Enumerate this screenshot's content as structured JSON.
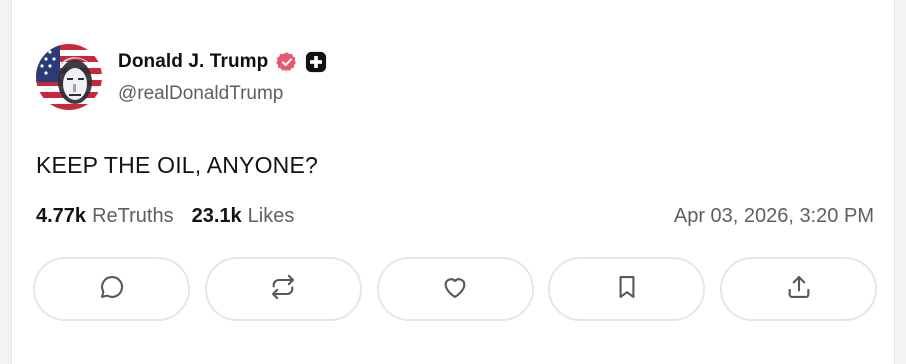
{
  "post": {
    "author": {
      "name": "Donald J. Trump",
      "handle": "@realDonaldTrump"
    },
    "text": "KEEP THE OIL, ANYONE?",
    "stats": {
      "retruths_count": "4.77k",
      "retruths_label": "ReTruths",
      "likes_count": "23.1k",
      "likes_label": "Likes"
    },
    "timestamp": "Apr 03, 2026, 3:20 PM"
  },
  "actions": [
    {
      "icon": "reply-icon"
    },
    {
      "icon": "retruth-icon"
    },
    {
      "icon": "heart-icon"
    },
    {
      "icon": "bookmark-icon"
    },
    {
      "icon": "share-icon"
    }
  ],
  "colors": {
    "verified_badge": "#e55a72",
    "text_primary": "#111116",
    "text_secondary": "#5c5f66",
    "button_border": "#e6e6ea"
  }
}
